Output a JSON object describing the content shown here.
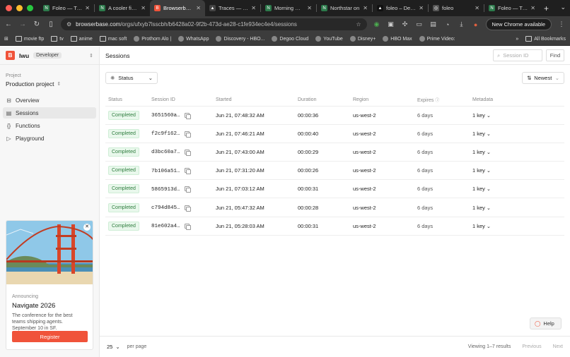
{
  "browser": {
    "tabs": [
      {
        "title": "Foleo — Trus",
        "color": "#2c7a4b",
        "glyph": "N",
        "active": false
      },
      {
        "title": "A cooler findi",
        "color": "#2c7a4b",
        "glyph": "N",
        "active": false
      },
      {
        "title": "Browserbase",
        "color": "#f0533a",
        "glyph": "B",
        "active": true
      },
      {
        "title": "Traces — folo",
        "color": "#444444",
        "glyph": "▲",
        "active": false
      },
      {
        "title": "Morning mile",
        "color": "#2c7a4b",
        "glyph": "N",
        "active": false
      },
      {
        "title": "Northstar on",
        "color": "#2c7a4b",
        "glyph": "N",
        "active": false
      },
      {
        "title": "foleo – Deplo",
        "color": "#111111",
        "glyph": "▲",
        "active": false
      },
      {
        "title": "foleo",
        "color": "#555555",
        "glyph": "◎",
        "active": false
      },
      {
        "title": "Foleo — Trus",
        "color": "#2c7a4b",
        "glyph": "N",
        "active": false
      }
    ],
    "url_host": "browserbase.com",
    "url_path": "/orgs/ufxyb7lsscbh/b6428a02-9f2b-473d-ae28-c1fe934ec4e4/sessions",
    "update_label": "New Chrome available",
    "bookmarks": [
      {
        "label": "movie ftp",
        "icon": "folder"
      },
      {
        "label": "tv",
        "icon": "folder"
      },
      {
        "label": "anime",
        "icon": "folder"
      },
      {
        "label": "mac soft",
        "icon": "folder"
      },
      {
        "label": "Prothom Alo |",
        "icon": "site"
      },
      {
        "label": "WhatsApp",
        "icon": "site"
      },
      {
        "label": "Discovery - HBO...",
        "icon": "site"
      },
      {
        "label": "Degoo Cloud",
        "icon": "site"
      },
      {
        "label": "YouTube",
        "icon": "site"
      },
      {
        "label": "Disney+",
        "icon": "site"
      },
      {
        "label": "HBO Max",
        "icon": "site"
      },
      {
        "label": "Prime Video:",
        "icon": "site"
      }
    ],
    "all_bookmarks": "All Bookmarks"
  },
  "sidebar": {
    "logo": "B",
    "org_name": "Iwu",
    "org_badge": "Developer",
    "project_label": "Project",
    "project_name": "Production project",
    "nav": [
      {
        "label": "Overview",
        "icon": "overview-icon",
        "glyph": "⊟",
        "active": false
      },
      {
        "label": "Sessions",
        "icon": "sessions-icon",
        "glyph": "▤",
        "active": true
      },
      {
        "label": "Functions",
        "icon": "functions-icon",
        "glyph": "{}",
        "active": false
      },
      {
        "label": "Playground",
        "icon": "playground-icon",
        "glyph": "▷",
        "active": false
      }
    ],
    "promo": {
      "kicker": "Announcing",
      "title": "Navigate 2026",
      "description": "The conference for the best teams shipping agents. September 10 in SF.",
      "button": "Register"
    }
  },
  "main": {
    "title": "Sessions",
    "search_placeholder": "Session ID",
    "find_label": "Find",
    "status_filter": "Status",
    "sort_label": "Newest",
    "columns": [
      "Status",
      "Session ID",
      "Started",
      "Duration",
      "Region",
      "Expires",
      "Metadata"
    ],
    "rows": [
      {
        "status": "Completed",
        "id": "3651560a…",
        "started": "Jun 21, 07:48:32 AM",
        "duration": "00:00:36",
        "region": "us-west-2",
        "expires": "6 days",
        "metadata": "1 key"
      },
      {
        "status": "Completed",
        "id": "f2c9f162…",
        "started": "Jun 21, 07:46:21 AM",
        "duration": "00:00:40",
        "region": "us-west-2",
        "expires": "6 days",
        "metadata": "1 key"
      },
      {
        "status": "Completed",
        "id": "d3bc60a7…",
        "started": "Jun 21, 07:43:00 AM",
        "duration": "00:00:29",
        "region": "us-west-2",
        "expires": "6 days",
        "metadata": "1 key"
      },
      {
        "status": "Completed",
        "id": "7b106a51…",
        "started": "Jun 21, 07:31:20 AM",
        "duration": "00:00:26",
        "region": "us-west-2",
        "expires": "6 days",
        "metadata": "1 key"
      },
      {
        "status": "Completed",
        "id": "5865913d…",
        "started": "Jun 21, 07:03:12 AM",
        "duration": "00:00:31",
        "region": "us-west-2",
        "expires": "6 days",
        "metadata": "1 key"
      },
      {
        "status": "Completed",
        "id": "c794d845…",
        "started": "Jun 21, 05:47:32 AM",
        "duration": "00:00:28",
        "region": "us-west-2",
        "expires": "6 days",
        "metadata": "1 key"
      },
      {
        "status": "Completed",
        "id": "81e602a4…",
        "started": "Jun 21, 05:28:03 AM",
        "duration": "00:00:31",
        "region": "us-west-2",
        "expires": "6 days",
        "metadata": "1 key"
      }
    ],
    "help_label": "Help",
    "footer": {
      "page_size": "25",
      "per_page": "per page",
      "viewing": "Viewing 1–7 results",
      "previous": "Previous",
      "next": "Next"
    }
  },
  "colors": {
    "accent": "#f0533a",
    "completed_bg": "#e9f8ec",
    "completed_fg": "#2e7d3e"
  }
}
